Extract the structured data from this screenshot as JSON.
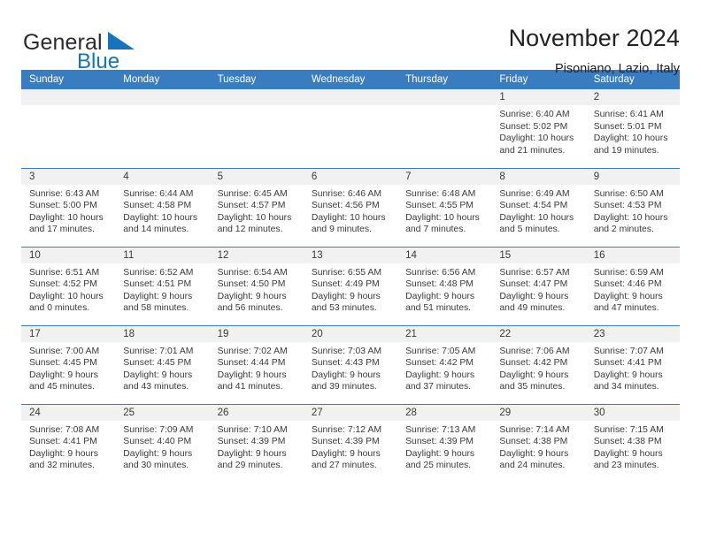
{
  "brand": {
    "name_part1": "General",
    "name_part2": "Blue",
    "flag_icon": "blue-triangle-flag-icon",
    "accent_color": "#1673bc"
  },
  "header": {
    "title": "November 2024",
    "subtitle": "Pisoniano, Lazio, Italy"
  },
  "calendar": {
    "header_bg": "#3a7cc0",
    "daynum_bg": "#f1f1f1",
    "weekdays": [
      "Sunday",
      "Monday",
      "Tuesday",
      "Wednesday",
      "Thursday",
      "Friday",
      "Saturday"
    ],
    "weeks": [
      [
        {
          "day": "",
          "lines": []
        },
        {
          "day": "",
          "lines": []
        },
        {
          "day": "",
          "lines": []
        },
        {
          "day": "",
          "lines": []
        },
        {
          "day": "",
          "lines": []
        },
        {
          "day": "1",
          "lines": [
            "Sunrise: 6:40 AM",
            "Sunset: 5:02 PM",
            "Daylight: 10 hours",
            "and 21 minutes."
          ]
        },
        {
          "day": "2",
          "lines": [
            "Sunrise: 6:41 AM",
            "Sunset: 5:01 PM",
            "Daylight: 10 hours",
            "and 19 minutes."
          ]
        }
      ],
      [
        {
          "day": "3",
          "lines": [
            "Sunrise: 6:43 AM",
            "Sunset: 5:00 PM",
            "Daylight: 10 hours",
            "and 17 minutes."
          ]
        },
        {
          "day": "4",
          "lines": [
            "Sunrise: 6:44 AM",
            "Sunset: 4:58 PM",
            "Daylight: 10 hours",
            "and 14 minutes."
          ]
        },
        {
          "day": "5",
          "lines": [
            "Sunrise: 6:45 AM",
            "Sunset: 4:57 PM",
            "Daylight: 10 hours",
            "and 12 minutes."
          ]
        },
        {
          "day": "6",
          "lines": [
            "Sunrise: 6:46 AM",
            "Sunset: 4:56 PM",
            "Daylight: 10 hours",
            "and 9 minutes."
          ]
        },
        {
          "day": "7",
          "lines": [
            "Sunrise: 6:48 AM",
            "Sunset: 4:55 PM",
            "Daylight: 10 hours",
            "and 7 minutes."
          ]
        },
        {
          "day": "8",
          "lines": [
            "Sunrise: 6:49 AM",
            "Sunset: 4:54 PM",
            "Daylight: 10 hours",
            "and 5 minutes."
          ]
        },
        {
          "day": "9",
          "lines": [
            "Sunrise: 6:50 AM",
            "Sunset: 4:53 PM",
            "Daylight: 10 hours",
            "and 2 minutes."
          ]
        }
      ],
      [
        {
          "day": "10",
          "lines": [
            "Sunrise: 6:51 AM",
            "Sunset: 4:52 PM",
            "Daylight: 10 hours",
            "and 0 minutes."
          ]
        },
        {
          "day": "11",
          "lines": [
            "Sunrise: 6:52 AM",
            "Sunset: 4:51 PM",
            "Daylight: 9 hours",
            "and 58 minutes."
          ]
        },
        {
          "day": "12",
          "lines": [
            "Sunrise: 6:54 AM",
            "Sunset: 4:50 PM",
            "Daylight: 9 hours",
            "and 56 minutes."
          ]
        },
        {
          "day": "13",
          "lines": [
            "Sunrise: 6:55 AM",
            "Sunset: 4:49 PM",
            "Daylight: 9 hours",
            "and 53 minutes."
          ]
        },
        {
          "day": "14",
          "lines": [
            "Sunrise: 6:56 AM",
            "Sunset: 4:48 PM",
            "Daylight: 9 hours",
            "and 51 minutes."
          ]
        },
        {
          "day": "15",
          "lines": [
            "Sunrise: 6:57 AM",
            "Sunset: 4:47 PM",
            "Daylight: 9 hours",
            "and 49 minutes."
          ]
        },
        {
          "day": "16",
          "lines": [
            "Sunrise: 6:59 AM",
            "Sunset: 4:46 PM",
            "Daylight: 9 hours",
            "and 47 minutes."
          ]
        }
      ],
      [
        {
          "day": "17",
          "lines": [
            "Sunrise: 7:00 AM",
            "Sunset: 4:45 PM",
            "Daylight: 9 hours",
            "and 45 minutes."
          ]
        },
        {
          "day": "18",
          "lines": [
            "Sunrise: 7:01 AM",
            "Sunset: 4:45 PM",
            "Daylight: 9 hours",
            "and 43 minutes."
          ]
        },
        {
          "day": "19",
          "lines": [
            "Sunrise: 7:02 AM",
            "Sunset: 4:44 PM",
            "Daylight: 9 hours",
            "and 41 minutes."
          ]
        },
        {
          "day": "20",
          "lines": [
            "Sunrise: 7:03 AM",
            "Sunset: 4:43 PM",
            "Daylight: 9 hours",
            "and 39 minutes."
          ]
        },
        {
          "day": "21",
          "lines": [
            "Sunrise: 7:05 AM",
            "Sunset: 4:42 PM",
            "Daylight: 9 hours",
            "and 37 minutes."
          ]
        },
        {
          "day": "22",
          "lines": [
            "Sunrise: 7:06 AM",
            "Sunset: 4:42 PM",
            "Daylight: 9 hours",
            "and 35 minutes."
          ]
        },
        {
          "day": "23",
          "lines": [
            "Sunrise: 7:07 AM",
            "Sunset: 4:41 PM",
            "Daylight: 9 hours",
            "and 34 minutes."
          ]
        }
      ],
      [
        {
          "day": "24",
          "lines": [
            "Sunrise: 7:08 AM",
            "Sunset: 4:41 PM",
            "Daylight: 9 hours",
            "and 32 minutes."
          ]
        },
        {
          "day": "25",
          "lines": [
            "Sunrise: 7:09 AM",
            "Sunset: 4:40 PM",
            "Daylight: 9 hours",
            "and 30 minutes."
          ]
        },
        {
          "day": "26",
          "lines": [
            "Sunrise: 7:10 AM",
            "Sunset: 4:39 PM",
            "Daylight: 9 hours",
            "and 29 minutes."
          ]
        },
        {
          "day": "27",
          "lines": [
            "Sunrise: 7:12 AM",
            "Sunset: 4:39 PM",
            "Daylight: 9 hours",
            "and 27 minutes."
          ]
        },
        {
          "day": "28",
          "lines": [
            "Sunrise: 7:13 AM",
            "Sunset: 4:39 PM",
            "Daylight: 9 hours",
            "and 25 minutes."
          ]
        },
        {
          "day": "29",
          "lines": [
            "Sunrise: 7:14 AM",
            "Sunset: 4:38 PM",
            "Daylight: 9 hours",
            "and 24 minutes."
          ]
        },
        {
          "day": "30",
          "lines": [
            "Sunrise: 7:15 AM",
            "Sunset: 4:38 PM",
            "Daylight: 9 hours",
            "and 23 minutes."
          ]
        }
      ]
    ]
  }
}
